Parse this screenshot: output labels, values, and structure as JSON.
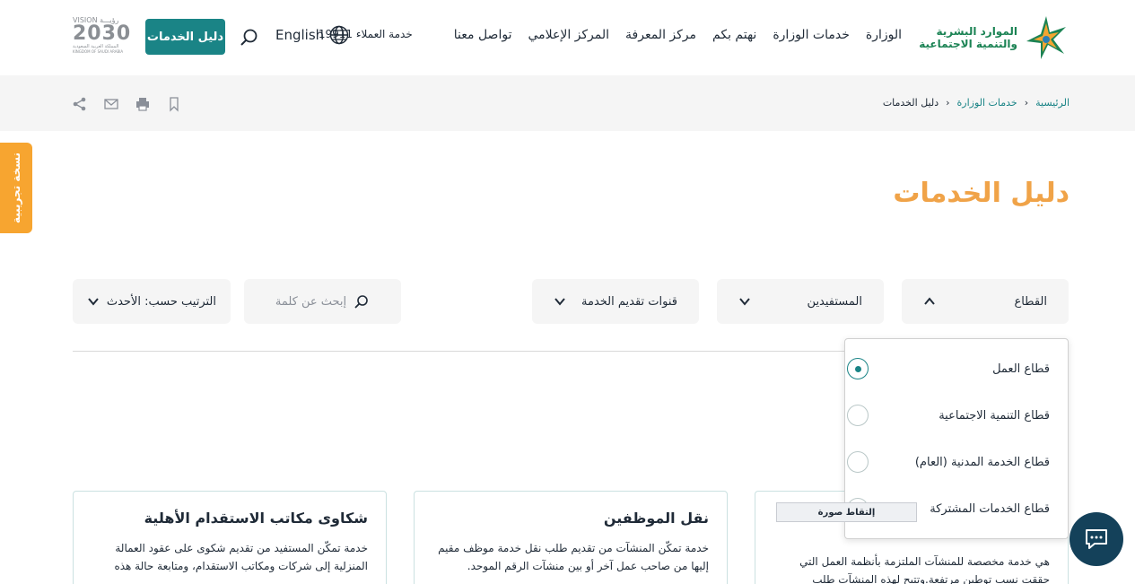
{
  "header": {
    "logo_line1": "الموارد البشرية",
    "logo_line2": "والتنمية الاجتماعية",
    "nav": [
      "الوزارة",
      "خدمات الوزارة",
      "نهتم بكم",
      "مركز المعرفة",
      "المركز الإعلامي",
      "تواصل معنا"
    ],
    "hotline": "خدمة العملاء 19911",
    "language": "English",
    "guide_button": "دليل الخدمات",
    "vision_top": "VISION رؤيـــة",
    "vision_year": "2030",
    "vision_bottom": "المملكة العربية السعودية",
    "vision_country": "KINGDOM OF SAUDI ARABIA"
  },
  "breadcrumb": {
    "home": "الرئيسية",
    "services": "خدمات الوزارة",
    "current": "دليل الخدمات"
  },
  "beta_tab": "نسخة تجريبية",
  "page_title": "دليل الخدمات",
  "filters": {
    "sector": "القطاع",
    "beneficiaries": "المستفيدين",
    "channels": "قنوات تقديم الخدمة",
    "search_placeholder": "إبحث عن كلمة",
    "sort": "الترتيب حسب: الأحدث"
  },
  "sector_options": [
    {
      "label": "قطاع العمل",
      "selected": true
    },
    {
      "label": "قطاع التنمية الاجتماعية",
      "selected": false
    },
    {
      "label": "قطاع الخدمة المدنية (العام)",
      "selected": false
    },
    {
      "label": "قطاع الخدمات المشتركة",
      "selected": false
    }
  ],
  "cards": [
    {
      "title": "شكاوى مكاتب الاستقدام الأهلية",
      "desc": "خدمة تمكّن المستفيد من تقديم شكوى على عقود العمالة المنزلية إلى شركات ومكاتب الاستقدام، ومتابعة حالة هذه"
    },
    {
      "title": "نقل الموظفين",
      "desc": "خدمة تمكّن المنشآت من تقديم طلب نقل خدمة موظف مقيم إليها من صاحب عمل آخر أو بين منشآت الرقم الموحد."
    },
    {
      "title": "",
      "desc": "هي خدمة مخصصة للمنشآت الملتزمة بأنظمة العمل التي حققت نسب توطين مرتفعة.وتتيح لهذه المنشآت طلب"
    }
  ],
  "capture_chip": "إلتقاط صورة",
  "colors": {
    "accent": "#1a8486",
    "title": "#f0a348",
    "beta": "#f7a530",
    "chat": "#14415a"
  }
}
